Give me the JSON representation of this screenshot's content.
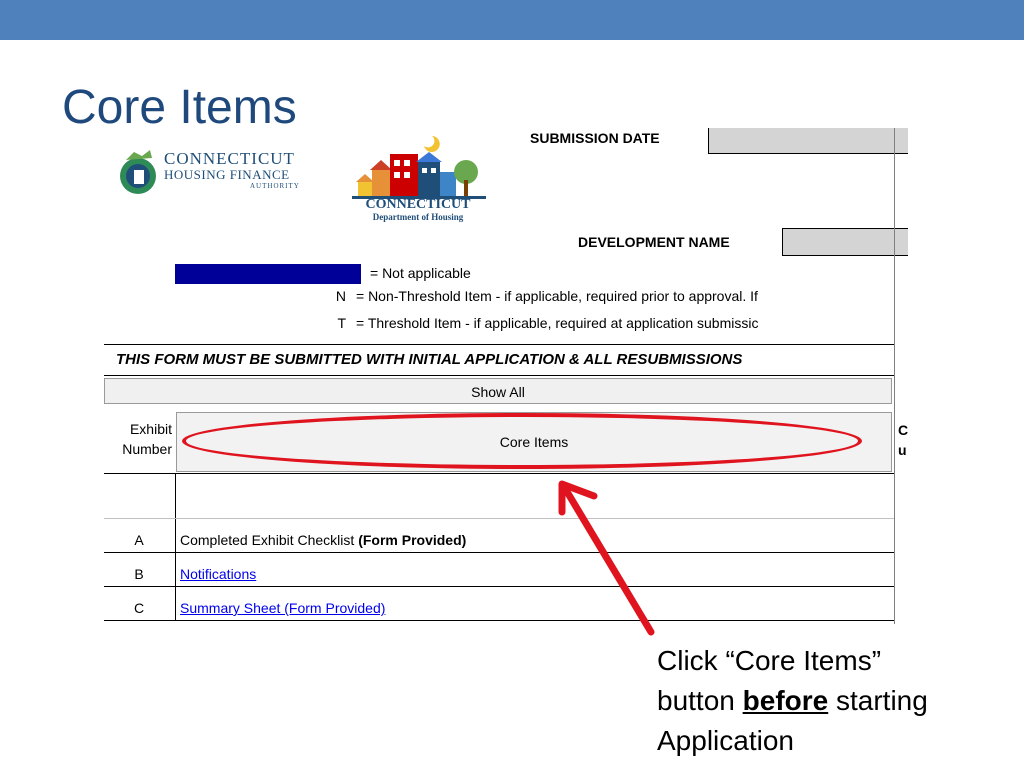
{
  "slide": {
    "title": "Core Items",
    "accent_color": "#4f81bd",
    "title_color": "#1f497d"
  },
  "sheet": {
    "submission_date_label": "SUBMISSION DATE",
    "development_name_label": "DEVELOPMENT NAME",
    "logos": {
      "chfa": {
        "line1": "CONNECTICUT",
        "line2": "HOUSING FINANCE",
        "line3": "AUTHORITY"
      },
      "doh": {
        "line1": "CONNECTICUT",
        "line2": "Department of Housing"
      }
    },
    "legend": {
      "not_applicable": "= Not applicable",
      "n_code": "N",
      "n_text": "= Non-Threshold Item - if applicable, required prior to approval.  If",
      "t_code": "T",
      "t_text": "= Threshold Item - if applicable, required at application submissic",
      "na_color": "#000099"
    },
    "banner": "THIS FORM MUST BE SUBMITTED WITH INITIAL APPLICATION & ALL RESUBMISSIONS",
    "show_all_button": "Show All",
    "header": {
      "exhibit_line1": "Exhibit",
      "exhibit_line2": "Number",
      "core_items_button": "Core Items",
      "trunc_line1": "C",
      "trunc_line2": "u"
    },
    "rows": [
      {
        "letter": "A",
        "text": "Completed Exhibit Checklist ",
        "bold": "(Form Provided)",
        "link": false
      },
      {
        "letter": "B",
        "text": "Notifications",
        "bold": "",
        "link": true
      },
      {
        "letter": "C",
        "text": "Summary Sheet (Form Provided)",
        "bold": "",
        "link": true
      }
    ]
  },
  "annotation": {
    "color": "#e0141e",
    "line1": "Click “Core Items”",
    "line2_pre": "button ",
    "line2_bold": "before",
    "line2_post": " starting",
    "line3": "Application"
  }
}
